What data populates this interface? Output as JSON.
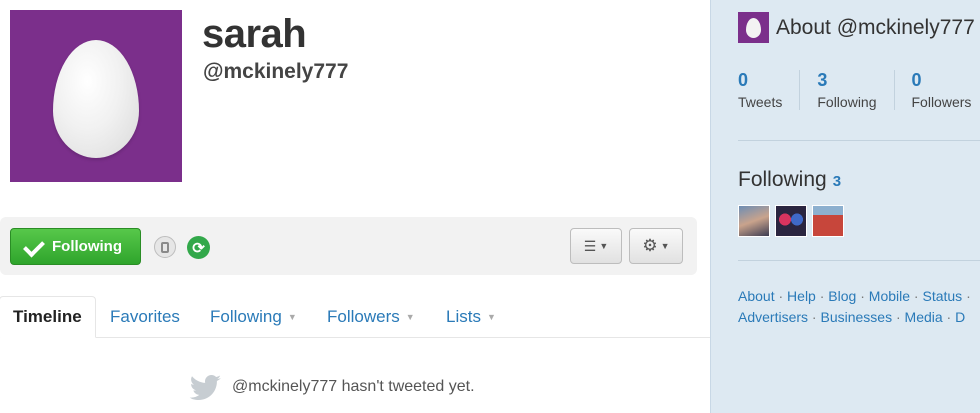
{
  "profile": {
    "fullname": "sarah",
    "handle": "@mckinely777",
    "avatar_color": "#7b2f8b"
  },
  "actions": {
    "following_label": "Following",
    "sms_icon": "phone-icon",
    "retweet_icon": "retweet-icon",
    "list_icon": "list-icon",
    "gear_icon": "gear-icon"
  },
  "tabs": [
    {
      "label": "Timeline",
      "active": true
    },
    {
      "label": "Favorites"
    },
    {
      "label": "Following",
      "dropdown": true
    },
    {
      "label": "Followers",
      "dropdown": true
    },
    {
      "label": "Lists",
      "dropdown": true
    }
  ],
  "empty_message": "@mckinely777 hasn't tweeted yet.",
  "sidebar": {
    "about_title": "About @mckinely777",
    "stats": [
      {
        "num": "0",
        "label": "Tweets"
      },
      {
        "num": "3",
        "label": "Following"
      },
      {
        "num": "0",
        "label": "Followers"
      }
    ],
    "following_title": "Following",
    "following_count": "3",
    "footer_line1": [
      "About",
      "Help",
      "Blog",
      "Mobile",
      "Status",
      ""
    ],
    "footer_line2": [
      "Advertisers",
      "Businesses",
      "Media",
      "D"
    ]
  },
  "colors": {
    "link": "#2a7ab8",
    "follow_button": "#2fa52c",
    "sidebar_bg": "#dde9f2"
  }
}
